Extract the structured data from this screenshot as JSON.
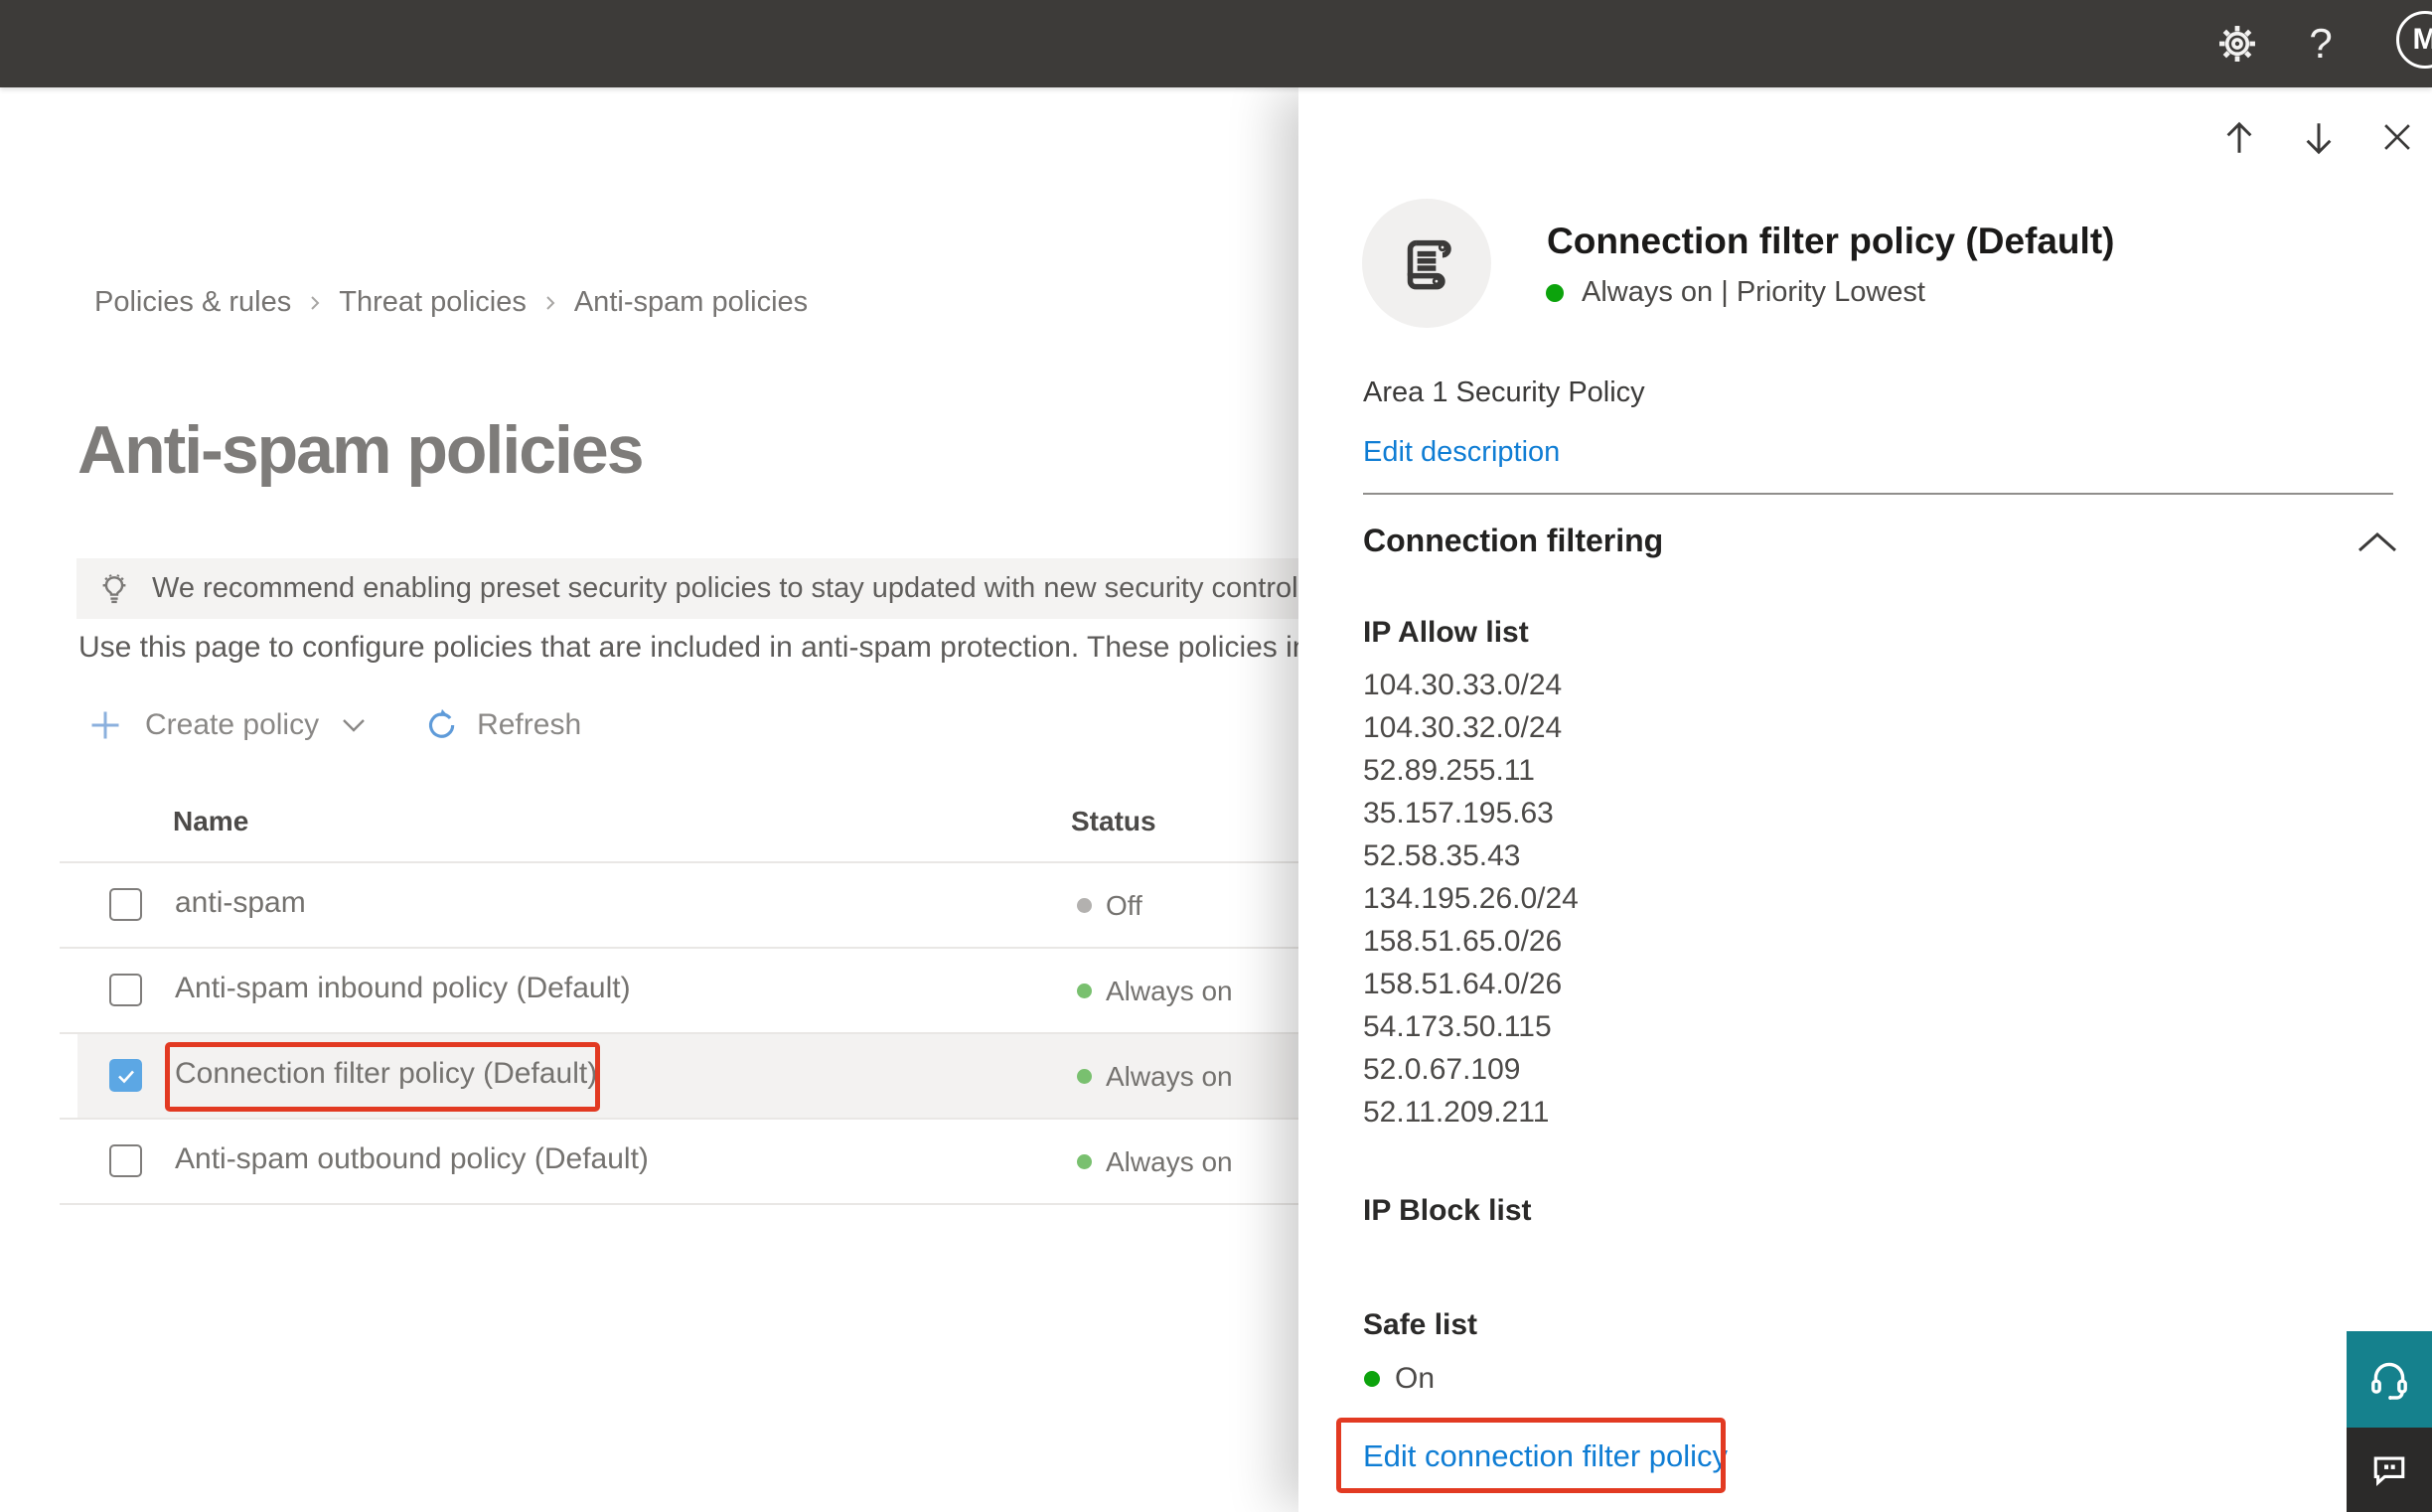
{
  "topbar": {
    "help_label": "?",
    "avatar_initial": "M"
  },
  "breadcrumb": [
    "Policies & rules",
    "Threat policies",
    "Anti-spam policies"
  ],
  "page": {
    "title": "Anti-spam policies",
    "recommendation": "We recommend enabling preset security policies to stay updated with new security controls and our recomme",
    "description": "Use this page to configure policies that are included in anti-spam protection. These policies include"
  },
  "toolbar": {
    "create": "Create policy",
    "refresh": "Refresh"
  },
  "table": {
    "columns": {
      "name": "Name",
      "status": "Status"
    },
    "rows": [
      {
        "name": "anti-spam",
        "status": "Off",
        "checked": false,
        "selected": false
      },
      {
        "name": "Anti-spam inbound policy (Default)",
        "status": "Always on",
        "checked": false,
        "selected": false
      },
      {
        "name": "Connection filter policy (Default)",
        "status": "Always on",
        "checked": true,
        "selected": true
      },
      {
        "name": "Anti-spam outbound policy (Default)",
        "status": "Always on",
        "checked": false,
        "selected": false
      }
    ]
  },
  "panel": {
    "title": "Connection filter policy (Default)",
    "status": "Always on | Priority Lowest",
    "description": "Area 1 Security Policy",
    "edit_description": "Edit description",
    "section": "Connection filtering",
    "ip_allow": {
      "title": "IP Allow list",
      "items": [
        "104.30.33.0/24",
        "104.30.32.0/24",
        "52.89.255.11",
        "35.157.195.63",
        "52.58.35.43",
        "134.195.26.0/24",
        "158.51.65.0/26",
        "158.51.64.0/26",
        "54.173.50.115",
        "52.0.67.109",
        "52.11.209.211"
      ]
    },
    "ip_block": {
      "title": "IP Block list"
    },
    "safe_list": {
      "title": "Safe list",
      "status": "On"
    },
    "edit_link": "Edit connection filter policy"
  },
  "icons": {
    "gear": "settings",
    "help": "question-mark",
    "avatar": "initial-circle",
    "lightbulb": "recommendation",
    "plus": "add",
    "refresh": "circular-arrow",
    "chevron_down": "expand",
    "chevron_up": "collapse",
    "arrow_up": "move-up",
    "arrow_down": "move-down",
    "close": "x",
    "scroll": "policy-document",
    "headset": "support",
    "speech_bubble": "feedback",
    "check": "checkmark"
  },
  "colors": {
    "topbar_bg": "#3d3b39",
    "accent_link": "#0f7dd4",
    "annotation_red": "#e23a22",
    "status_on_soft": "#79c06f",
    "status_on_vivid": "#0ca30c",
    "status_off": "#b3b1af",
    "checkbox_checked": "#5ca7e4",
    "selected_row_bg": "#f3f2f1",
    "support_teal": "#15818d",
    "feedback_dark": "#2b2a29",
    "banner_bg": "#f4f3f2"
  }
}
